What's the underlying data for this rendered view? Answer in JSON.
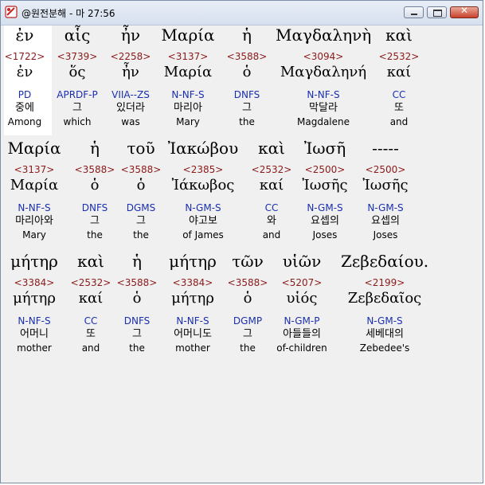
{
  "window": {
    "title": "@원전분해 - 마 27:56"
  },
  "rows": [
    [
      {
        "greek": "ἐν",
        "num": "<1722>",
        "lexeme": "ἐν",
        "parsing": "PD",
        "korean": "중에",
        "english": "Among"
      },
      {
        "greek": "αἷς",
        "num": "<3739>",
        "lexeme": "ὅς",
        "parsing": "APRDF-P",
        "korean": "그",
        "english": "which"
      },
      {
        "greek": "ἦν",
        "num": "<2258>",
        "lexeme": "ἦν",
        "parsing": "VIIA--ZS",
        "korean": "있더라",
        "english": "was"
      },
      {
        "greek": "Μαρία",
        "num": "<3137>",
        "lexeme": "Μαρία",
        "parsing": "N-NF-S",
        "korean": "마리아",
        "english": "Mary"
      },
      {
        "greek": "ἡ",
        "num": "<3588>",
        "lexeme": "ὁ",
        "parsing": "DNFS",
        "korean": "그",
        "english": "the"
      },
      {
        "greek": "Μαγδαληνὴ",
        "num": "<3094>",
        "lexeme": "Μαγδαληνή",
        "parsing": "N-NF-S",
        "korean": "막달라",
        "english": "Magdalene"
      },
      {
        "greek": "καὶ",
        "num": "<2532>",
        "lexeme": "καί",
        "parsing": "CC",
        "korean": "또",
        "english": "and"
      }
    ],
    [
      {
        "greek": "Μαρία",
        "num": "<3137>",
        "lexeme": "Μαρία",
        "parsing": "N-NF-S",
        "korean": "마리아와",
        "english": "Mary"
      },
      {
        "greek": "ἡ",
        "num": "<3588>",
        "lexeme": "ὁ",
        "parsing": "DNFS",
        "korean": "그",
        "english": "the"
      },
      {
        "greek": "τοῦ",
        "num": "<3588>",
        "lexeme": "ὁ",
        "parsing": "DGMS",
        "korean": "그",
        "english": "the"
      },
      {
        "greek": "Ἰακώβου",
        "num": "<2385>",
        "lexeme": "Ἰάκωβος",
        "parsing": "N-GM-S",
        "korean": "야고보",
        "english": "of James"
      },
      {
        "greek": "καὶ",
        "num": "<2532>",
        "lexeme": "καί",
        "parsing": "CC",
        "korean": "와",
        "english": "and"
      },
      {
        "greek": "Ἰωσῆ",
        "num": "<2500>",
        "lexeme": "Ἰωσῆς",
        "parsing": "N-GM-S",
        "korean": "요셉의",
        "english": "Joses"
      },
      {
        "greek": "-----",
        "num": "<2500>",
        "lexeme": "Ἰωσῆς",
        "parsing": "N-GM-S",
        "korean": "요셉의",
        "english": "Joses"
      }
    ],
    [
      {
        "greek": "μήτηρ",
        "num": "<3384>",
        "lexeme": "μήτηρ",
        "parsing": "N-NF-S",
        "korean": "어머니",
        "english": "mother"
      },
      {
        "greek": "καὶ",
        "num": "<2532>",
        "lexeme": "καί",
        "parsing": "CC",
        "korean": "또",
        "english": "and"
      },
      {
        "greek": "ἡ",
        "num": "<3588>",
        "lexeme": "ὁ",
        "parsing": "DNFS",
        "korean": "그",
        "english": "the"
      },
      {
        "greek": "μήτηρ",
        "num": "<3384>",
        "lexeme": "μήτηρ",
        "parsing": "N-NF-S",
        "korean": "어머니도",
        "english": "mother"
      },
      {
        "greek": "τῶν",
        "num": "<3588>",
        "lexeme": "ὁ",
        "parsing": "DGMP",
        "korean": "그",
        "english": "the"
      },
      {
        "greek": "υἱῶν",
        "num": "<5207>",
        "lexeme": "υἱός",
        "parsing": "N-GM-P",
        "korean": "아들들의",
        "english": "of-children"
      },
      {
        "greek": "Ζεβεδαίου.",
        "num": "<2199>",
        "lexeme": "Ζεβεδαῖος",
        "parsing": "N-GM-S",
        "korean": "세베대의",
        "english": "Zebedee's"
      }
    ]
  ]
}
